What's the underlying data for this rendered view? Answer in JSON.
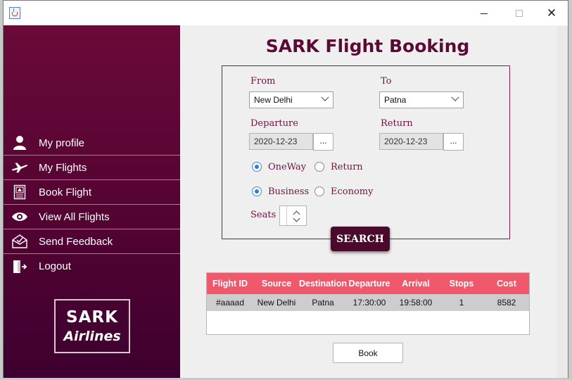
{
  "window": {
    "app_icon": "java-cup-icon",
    "min_icon": "minimize-icon",
    "max_icon": "maximize-icon",
    "close_glyph": "✕"
  },
  "sidebar": {
    "items": [
      {
        "label": "My profile",
        "icon": "user-icon"
      },
      {
        "label": "My Flights",
        "icon": "airplane-icon"
      },
      {
        "label": "Book Flight",
        "icon": "booking-icon"
      },
      {
        "label": "View All Flights",
        "icon": "eye-icon"
      },
      {
        "label": "Send Feedback",
        "icon": "feedback-mail-icon"
      },
      {
        "label": "Logout",
        "icon": "logout-icon"
      }
    ],
    "logo_line1": "SARK",
    "logo_line2": "Airlines"
  },
  "main": {
    "title": "SARK Flight Booking",
    "form": {
      "from_label": "From",
      "from_value": "New Delhi",
      "to_label": "To",
      "to_value": "Patna",
      "departure_label": "Departure",
      "departure_value": "2020-12-23",
      "return_label": "Return",
      "return_value": "2020-12-23",
      "picker_label": "...",
      "trip_options": [
        {
          "label": "OneWay",
          "selected": true
        },
        {
          "label": "Return",
          "selected": false
        }
      ],
      "class_options": [
        {
          "label": "Business",
          "selected": true
        },
        {
          "label": "Economy",
          "selected": false
        }
      ],
      "seats_label": "Seats",
      "search_label": "SEARCH"
    },
    "results": {
      "columns": [
        "Flight ID",
        "Source",
        "Destination",
        "Departure",
        "Arrival",
        "Stops",
        "Cost"
      ],
      "rows": [
        [
          "#aaaad",
          "New Delhi",
          "Patna",
          "17:30:00",
          "19:58:00",
          "1",
          "8582"
        ]
      ]
    },
    "book_label": "Book"
  },
  "colors": {
    "sidebar_top": "#6a0a39",
    "sidebar_bottom": "#3d0030",
    "title": "#5c0a35",
    "label": "#6a1540",
    "table_header": "#f0596b",
    "search_button": "#4a0a2b"
  }
}
